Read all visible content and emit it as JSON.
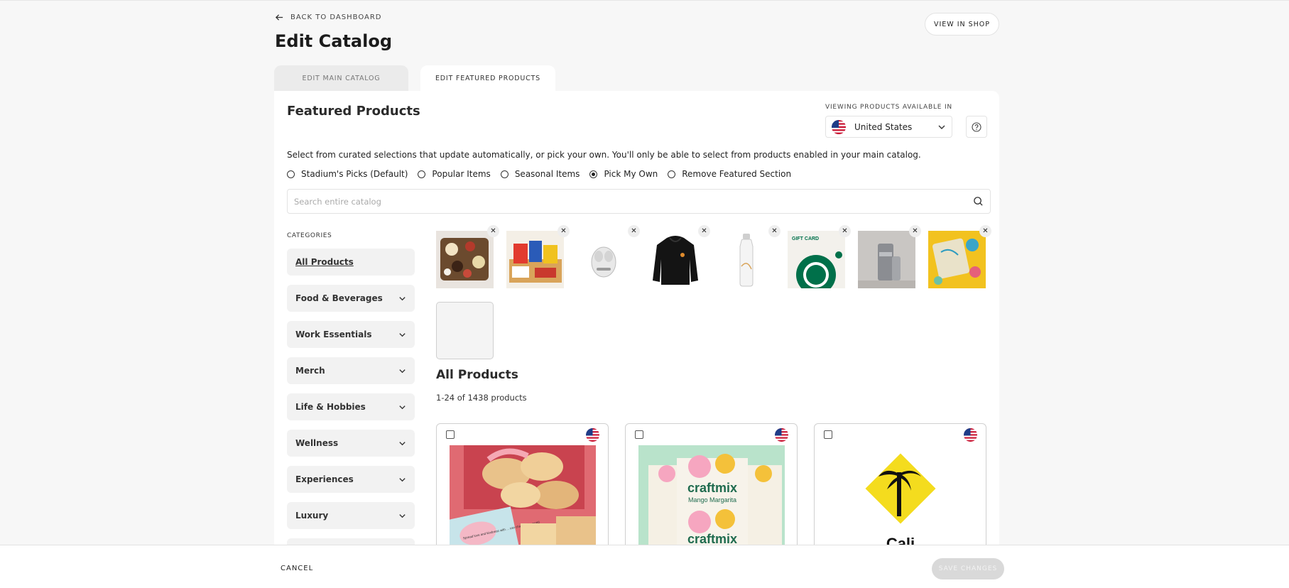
{
  "header": {
    "back_label": "BACK TO DASHBOARD",
    "title": "Edit Catalog",
    "view_shop_label": "VIEW IN SHOP"
  },
  "tabs": [
    {
      "label": "EDIT MAIN CATALOG",
      "active": false
    },
    {
      "label": "EDIT FEATURED PRODUCTS",
      "active": true
    }
  ],
  "featured": {
    "title": "Featured Products",
    "viewing_label": "VIEWING PRODUCTS AVAILABLE IN",
    "country": "United States",
    "description": "Select from curated selections that update automatically, or pick your own. You'll only be able to select from products enabled in your main catalog.",
    "options": [
      {
        "label": "Stadium's Picks (Default)",
        "selected": false
      },
      {
        "label": "Popular Items",
        "selected": false
      },
      {
        "label": "Seasonal Items",
        "selected": false
      },
      {
        "label": "Pick My Own",
        "selected": true
      },
      {
        "label": "Remove Featured Section",
        "selected": false
      }
    ],
    "search_placeholder": "Search entire catalog",
    "selected_items": [
      {
        "icon": "charcuterie-board-image"
      },
      {
        "icon": "snack-box-image"
      },
      {
        "icon": "earbuds-image"
      },
      {
        "icon": "black-hoodie-image"
      },
      {
        "icon": "water-bottle-image"
      },
      {
        "icon": "starbucks-gift-card-image",
        "label": "GIFT CARD"
      },
      {
        "icon": "skincare-bottles-image"
      },
      {
        "icon": "craft-kit-image"
      }
    ]
  },
  "categories": {
    "label": "CATEGORIES",
    "items": [
      {
        "label": "All Products",
        "active": true
      },
      {
        "label": "Food & Beverages"
      },
      {
        "label": "Work Essentials"
      },
      {
        "label": "Merch"
      },
      {
        "label": "Life & Hobbies"
      },
      {
        "label": "Wellness"
      },
      {
        "label": "Experiences"
      },
      {
        "label": "Luxury"
      }
    ]
  },
  "products": {
    "title": "All Products",
    "count": "1-24 of 1438 products",
    "cards": [
      {
        "image": "cookies-gift-box-image",
        "card_text": "Spread love and kindness with ... can change the world"
      },
      {
        "image": "craftmix-mango-margarita-image",
        "brand": "craftmix",
        "flavor": "Mango Margarita"
      },
      {
        "image": "palm-tree-sign-image",
        "partial_text": "Cali"
      }
    ]
  },
  "footer": {
    "cancel_label": "CANCEL",
    "save_label": "SAVE CHANGES"
  },
  "colors": {
    "background": "#f7f7f7",
    "panel": "#ffffff",
    "inactive_tab": "#ebebeb",
    "disabled_button": "#d9d9d9"
  }
}
